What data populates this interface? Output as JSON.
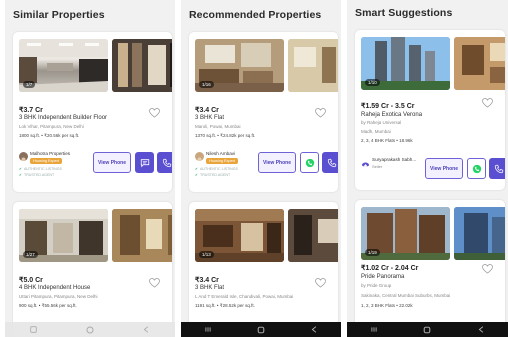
{
  "panels": [
    {
      "title": "Similar Properties",
      "cards": [
        {
          "image_count": "1/7",
          "price": "₹3.7 Cr",
          "title": "3 BHK Independent Builder Floor",
          "location": "Lok Vihar, Pitampura, New Delhi",
          "meta": "1800 sq.ft. • ₹20.56k per sq.ft.",
          "seller_name": "Malhotra Properties",
          "seller_badge": "Housing Expert",
          "tags": [
            "AUTHENTIC LISTINGS",
            "TRUSTED AGENT"
          ],
          "view_phone": "View Phone"
        },
        {
          "image_count": "1/27",
          "price": "₹5.0 Cr",
          "title": "4 BHK Independent House",
          "location": "Uttari Pitampura, Pitampura, New Delhi",
          "meta": "900 sq.ft. • ₹55.56k per sq.ft."
        }
      ]
    },
    {
      "title": "Recommended Properties",
      "cards": [
        {
          "image_count": "1/16",
          "price": "₹3.4 Cr",
          "title": "3 BHK Flat",
          "location": "Maroli, Powai, Mumbai",
          "meta": "1370 sq.ft. • ₹24.82k per sq.ft.",
          "seller_name": "Nilesh Ambavi",
          "seller_badge": "Housing Expert",
          "tags": [
            "AUTHENTIC LISTINGS",
            "TRUSTED AGENT"
          ],
          "view_phone": "View Phone"
        },
        {
          "image_count": "1/13",
          "price": "₹3.4 Cr",
          "title": "3 BHK Flat",
          "location": "L And T Emerald Isle, Chandivali, Powai, Mumbai",
          "meta": "1191 sq.ft. • ₹28.52k per sq.ft."
        }
      ]
    },
    {
      "title": "Smart Suggestions",
      "cards": [
        {
          "image_count": "1/10",
          "price": "₹1.59 Cr - 3.5 Cr",
          "title": "Raheja Exotica Verona",
          "developer": "by Raheja Universal",
          "location": "Madh, Mumbai",
          "meta": "2, 3, 4 BHK Flats • 18.96k",
          "seller_name": "Suryaprakash Sabh...",
          "seller_role": "Seller",
          "view_phone": "View Phone"
        },
        {
          "image_count": "1/19",
          "price": "₹1.02 Cr - 2.04 Cr",
          "title": "Pride Panorama",
          "developer": "by Pride Group",
          "location": "Sakinaka, Central Mumbai Suburbs, Mumbai",
          "meta": "1, 2, 3 BHK Flats • 22.02k"
        }
      ]
    }
  ],
  "colors": {
    "accent": "#5b4fd1",
    "badge": "#e9a53a",
    "verified": "#27a76a",
    "whatsapp": "#25d366"
  },
  "icons": {
    "favorite": "heart-outline-icon",
    "phone": "phone-icon",
    "chat": "chat-icon",
    "whatsapp": "whatsapp-icon",
    "nav": [
      "nav-recents-icon",
      "nav-home-icon",
      "nav-back-icon"
    ]
  }
}
